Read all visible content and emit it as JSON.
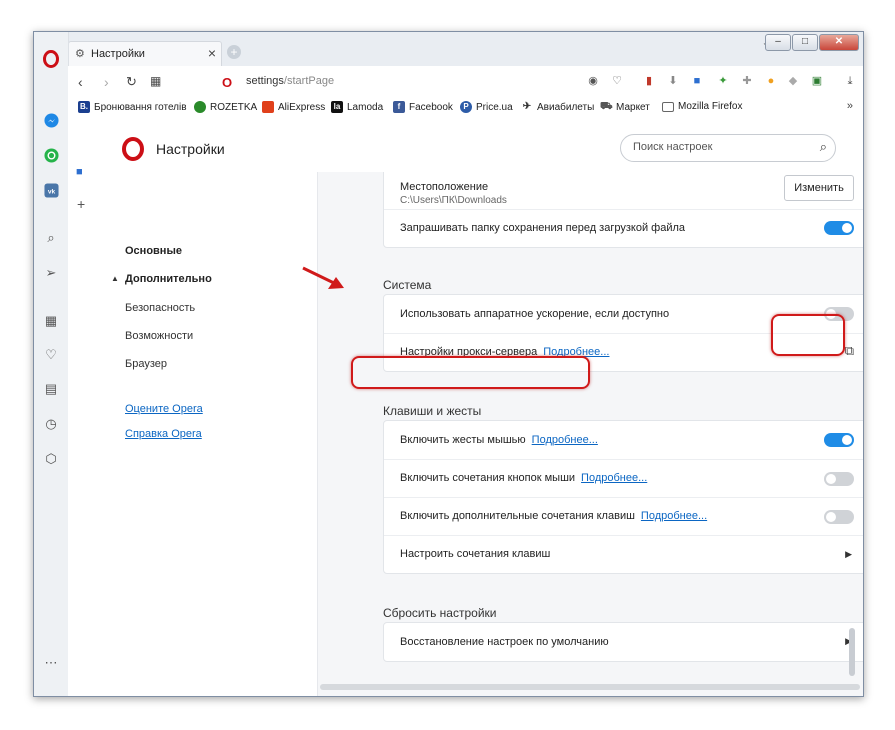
{
  "browser": {
    "tab": {
      "title": "Настройки"
    },
    "new_tab_symbol": "+",
    "url": {
      "host": "settings",
      "path": "/startPage"
    },
    "window_buttons": {
      "minimize": "–",
      "maximize": "□",
      "close": "✕"
    }
  },
  "bookmarks": [
    {
      "label": "Бронювання готелів",
      "icon_text": "B.",
      "color": "#1b3f8f"
    },
    {
      "label": "ROZETKA",
      "icon_text": "",
      "color": "#2a8a2a"
    },
    {
      "label": "AliExpress",
      "icon_text": "",
      "color": "#e0401b"
    },
    {
      "label": "Lamoda",
      "icon_text": "la",
      "color": "#111111"
    },
    {
      "label": "Facebook",
      "icon_text": "f",
      "color": "#3b5998"
    },
    {
      "label": "Price.ua",
      "icon_text": "P",
      "color": "#2d5ca8"
    },
    {
      "label": "Авиабилеты",
      "icon_text": "",
      "color": "#333333"
    },
    {
      "label": "Маркет",
      "icon_text": "",
      "color": "#555555"
    },
    {
      "label": "Mozilla Firefox",
      "icon_text": "",
      "color": "#666666"
    }
  ],
  "bookmarks_more": "»",
  "page": {
    "title": "Настройки",
    "search_placeholder": "Поиск настроек"
  },
  "leftnav": {
    "items": [
      "Основные",
      "Дополнительно",
      "Безопасность",
      "Возможности",
      "Браузер"
    ],
    "links": [
      "Оцените Opera",
      "Справка Opera"
    ]
  },
  "downloads": {
    "location_label": "Местоположение",
    "location_path": "C:\\Users\\ПК\\Downloads",
    "change_button": "Изменить",
    "ask_folder_label": "Запрашивать папку сохранения перед загрузкой файла",
    "ask_folder_on": true
  },
  "system": {
    "title": "Система",
    "hw_accel_label": "Использовать аппаратное ускорение, если доступно",
    "hw_accel_on": false,
    "proxy_label": "Настройки прокси-сервера",
    "proxy_link": "Подробнее..."
  },
  "shortcuts": {
    "title": "Клавиши и жесты",
    "rows": [
      {
        "label": "Включить жесты мышью",
        "link": "Подробнее...",
        "on": true
      },
      {
        "label": "Включить сочетания кнопок мыши",
        "link": "Подробнее...",
        "on": false
      },
      {
        "label": "Включить дополнительные сочетания клавиш",
        "link": "Подробнее...",
        "on": false
      }
    ],
    "configure_label": "Настроить сочетания клавиш"
  },
  "reset": {
    "title": "Сбросить настройки",
    "restore_label": "Восстановление настроек по умолчанию"
  },
  "colors": {
    "accent": "#1f8ce6",
    "opera_red": "#cc0f16",
    "highlight": "#d01a1a"
  }
}
